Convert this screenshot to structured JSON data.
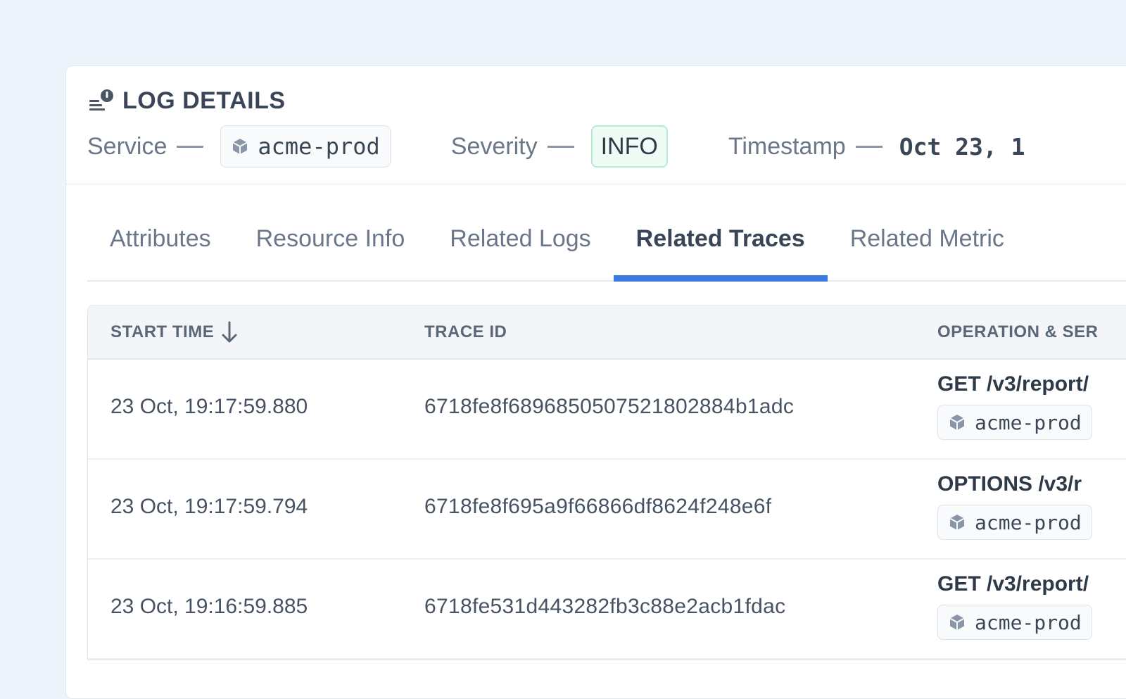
{
  "header": {
    "title": "LOG DETAILS",
    "title_icon": "log-alert-icon",
    "service_label": "Service",
    "service_value": "acme-prod",
    "service_icon": "cube-icon",
    "severity_label": "Severity",
    "severity_value": "INFO",
    "timestamp_label": "Timestamp",
    "timestamp_value": "Oct 23, 1",
    "colors": {
      "severity_info_border": "#b6ecd0",
      "severity_info_bg": "#effcf5"
    }
  },
  "tabs": [
    {
      "label": "Attributes",
      "active": false
    },
    {
      "label": "Resource Info",
      "active": false
    },
    {
      "label": "Related Logs",
      "active": false
    },
    {
      "label": "Related Traces",
      "active": true
    },
    {
      "label": "Related Metric",
      "active": false
    }
  ],
  "accent_color": "#3b78e0",
  "table": {
    "columns": [
      {
        "label": "START TIME",
        "sort": "descending",
        "sort_icon": "arrow-down-icon"
      },
      {
        "label": "TRACE ID"
      },
      {
        "label": "OPERATION & SER"
      }
    ],
    "rows": [
      {
        "start_time": "23 Oct, 19:17:59.880",
        "trace_id": "6718fe8f6896850507521802884b1adc",
        "operation": "GET /v3/report/",
        "service": "acme-prod"
      },
      {
        "start_time": "23 Oct, 19:17:59.794",
        "trace_id": "6718fe8f695a9f66866df8624f248e6f",
        "operation": "OPTIONS /v3/r",
        "service": "acme-prod"
      },
      {
        "start_time": "23 Oct, 19:16:59.885",
        "trace_id": "6718fe531d443282fb3c88e2acb1fdac",
        "operation": "GET /v3/report/",
        "service": "acme-prod"
      }
    ]
  }
}
